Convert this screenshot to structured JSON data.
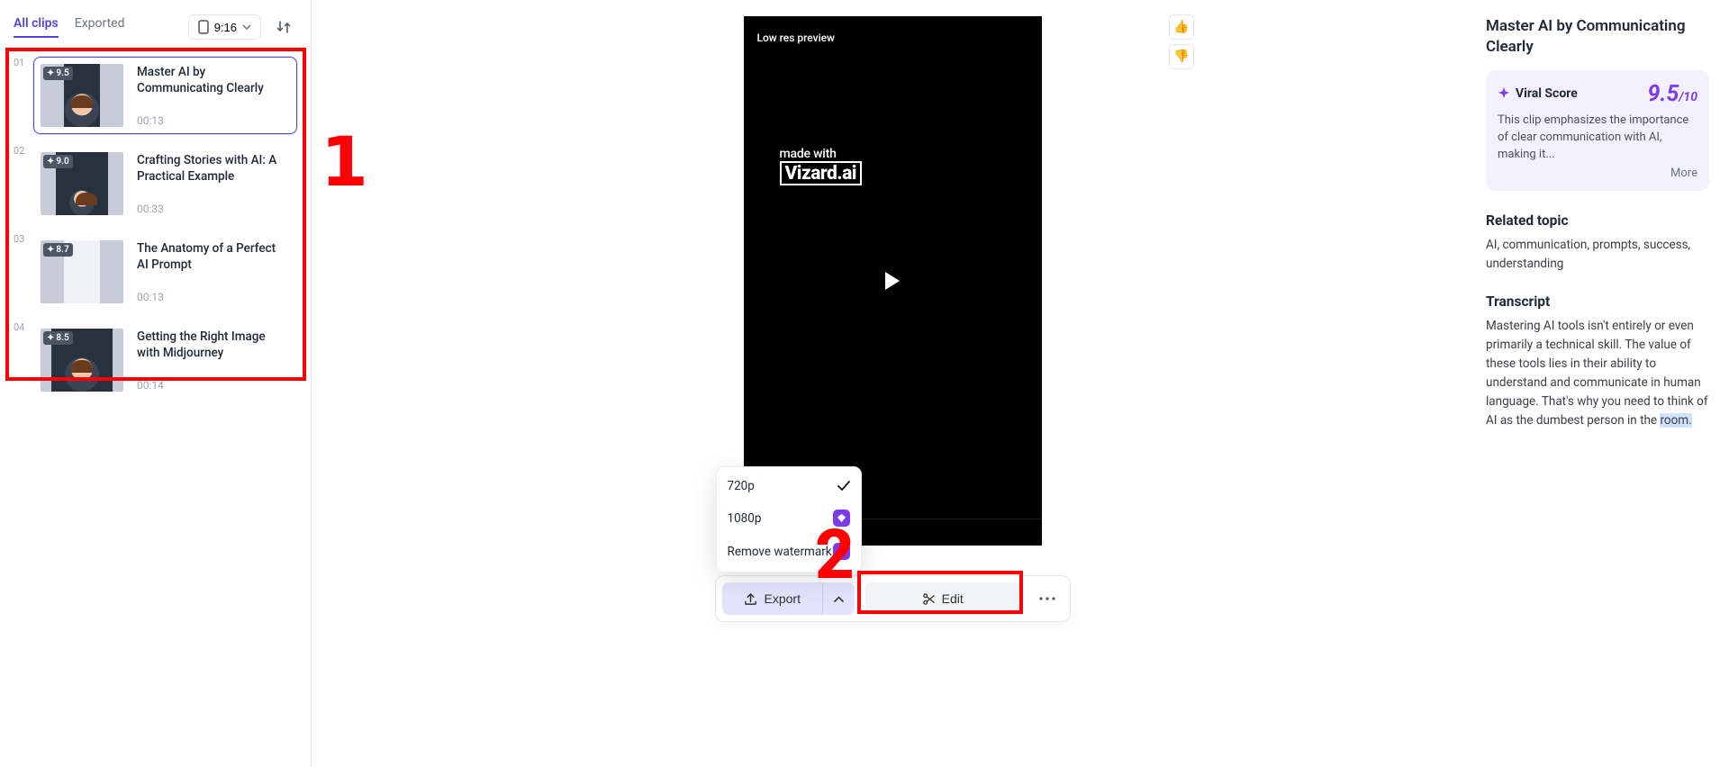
{
  "sidebar": {
    "tabs": [
      {
        "label": "All clips",
        "active": true
      },
      {
        "label": "Exported",
        "active": false
      }
    ],
    "aspect_ratio": "9:16",
    "clips": [
      {
        "num": "01",
        "score": "9.5",
        "title": "Master AI by Communicating Clearly",
        "duration": "00:13",
        "selected": true
      },
      {
        "num": "02",
        "score": "9.0",
        "title": "Crafting Stories with AI: A Practical Example",
        "duration": "00:33",
        "selected": false
      },
      {
        "num": "03",
        "score": "8.7",
        "title": "The Anatomy of a Perfect AI Prompt",
        "duration": "00:13",
        "selected": false
      },
      {
        "num": "04",
        "score": "8.5",
        "title": "Getting the Right Image with Midjourney",
        "duration": "00:14",
        "selected": false
      }
    ]
  },
  "center": {
    "preview_label": "Low res preview",
    "brand_madewith": "made with",
    "brand_name": "Vizard.ai",
    "export_menu": [
      {
        "label": "720p",
        "checked": true,
        "premium": false
      },
      {
        "label": "1080p",
        "checked": false,
        "premium": true
      },
      {
        "label": "Remove watermark",
        "checked": false,
        "premium": true
      }
    ],
    "export_label": "Export",
    "edit_label": "Edit"
  },
  "right": {
    "title": "Master AI by Communicating Clearly",
    "viral": {
      "label": "Viral Score",
      "score_big": "9.5",
      "score_suffix": "/10",
      "desc": "This clip emphasizes the importance of clear communication with AI, making it...",
      "more": "More"
    },
    "related": {
      "heading": "Related topic",
      "body": "AI, communication, prompts, success, understanding"
    },
    "transcript": {
      "heading": "Transcript",
      "body_before": "Mastering AI tools isn't entirely or even primarily a technical skill. The value of these tools lies in their ability to understand and communicate in human language. That's why you need to think of AI as the dumbest person in the ",
      "body_hl": "room.",
      "body_after": ""
    }
  },
  "annotations": {
    "box1": "1",
    "box2": "2"
  }
}
